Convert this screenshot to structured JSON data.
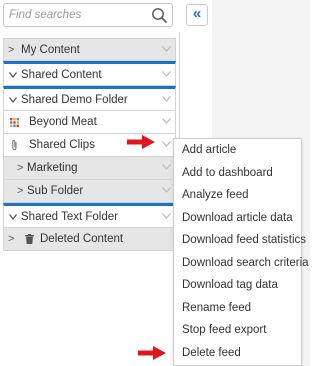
{
  "search": {
    "placeholder": "Find searches"
  },
  "tree": [
    {
      "label": "My Content"
    },
    {
      "label": "Shared Content"
    },
    {
      "label": "Shared Demo Folder"
    },
    {
      "label": "Beyond Meat"
    },
    {
      "label": "Shared Clips"
    },
    {
      "label": "Marketing"
    },
    {
      "label": "Sub Folder"
    },
    {
      "label": "Shared Text Folder"
    },
    {
      "label": "Deleted Content"
    }
  ],
  "menu": [
    "Add article",
    "Add to dashboard",
    "Analyze feed",
    "Download article data",
    "Download feed statistics",
    "Download search criteria",
    "Download tag data",
    "Rename feed",
    "Stop feed export",
    "Delete feed"
  ],
  "colors": {
    "accent": "#1b73c6",
    "arrow": "#e0141b",
    "row_gray": "#e6e6e6"
  },
  "icons": [
    "search-icon",
    "double-chevron-left-icon",
    "grid-icon",
    "paperclip-icon",
    "trash-icon",
    "red-arrow-icon"
  ]
}
